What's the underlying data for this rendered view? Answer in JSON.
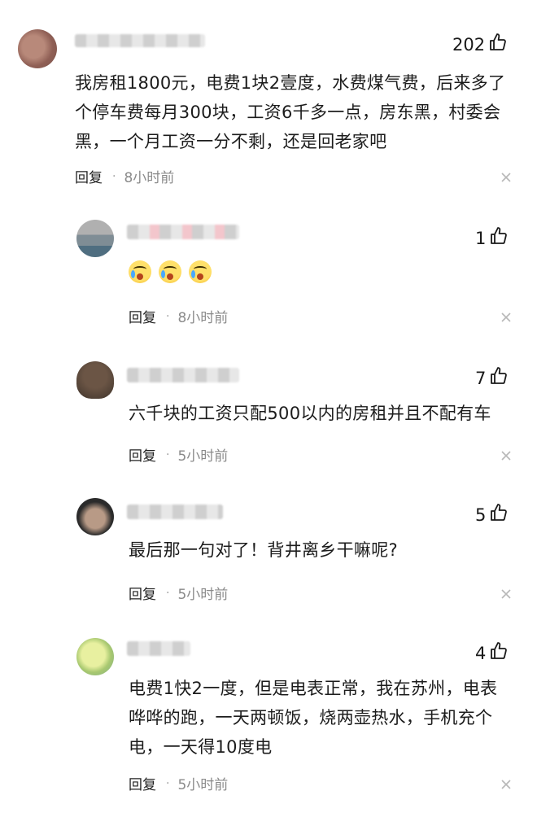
{
  "comments": [
    {
      "likes": "202",
      "text": "我房租1800元，电费1块2壹度，水费煤气费，后来多了个停车费每月300块，工资6千多一点，房东黑，村委会黑，一个月工资一分不剩，还是回老家吧",
      "reply": "回复",
      "time": "8小时前"
    },
    {
      "likes": "1",
      "text": "",
      "reply": "回复",
      "time": "8小时前"
    },
    {
      "likes": "7",
      "text": "六千块的工资只配500以内的房租并且不配有车",
      "reply": "回复",
      "time": "5小时前"
    },
    {
      "likes": "5",
      "text": "最后那一句对了！背井离乡干嘛呢?",
      "reply": "回复",
      "time": "5小时前"
    },
    {
      "likes": "4",
      "text": "电费1快2一度，但是电表正常，我在苏州，电表哗哗的跑，一天两顿饭，烧两壶热水，手机充个电，一天得10度电",
      "reply": "回复",
      "time": "5小时前"
    }
  ],
  "icons": {
    "like": "thumbs-up-icon",
    "close": "close-icon",
    "emoji": "crying-face-emoji"
  },
  "colors": {
    "meta_time": "#8a8a8a",
    "close": "#b8b8b8"
  }
}
